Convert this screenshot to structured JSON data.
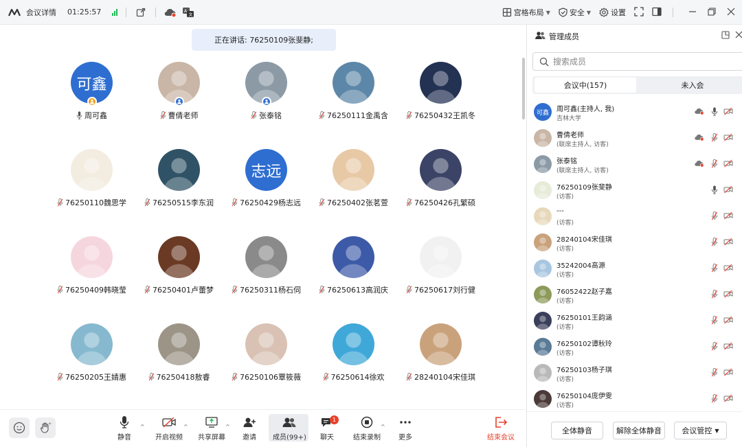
{
  "topbar": {
    "title": "会议详情",
    "time": "01:25:57",
    "layout_label": "宫格布局",
    "security_label": "安全",
    "settings_label": "设置"
  },
  "speaker": {
    "text": "正在讲话: 76250109张斐静;"
  },
  "participants": [
    {
      "name": "周可鑫",
      "avatar_text": "可鑫",
      "avatar_color": "#2e6ed1",
      "badge": "host",
      "mic": "on"
    },
    {
      "name": "曹倩老师",
      "avatar_text": "",
      "avatar_color": "#c9b6a6",
      "badge": "cohost",
      "mic": "off"
    },
    {
      "name": "张泰铭",
      "avatar_text": "",
      "avatar_color": "#8c9aa6",
      "badge": "cohost",
      "mic": "off"
    },
    {
      "name": "76250111金禹含",
      "avatar_text": "",
      "avatar_color": "#5d87a8",
      "badge": "",
      "mic": "off"
    },
    {
      "name": "76250432王凯冬",
      "avatar_text": "",
      "avatar_color": "#233152",
      "badge": "",
      "mic": "off"
    },
    {
      "name": "76250110魏思学",
      "avatar_text": "",
      "avatar_color": "#f3ece0",
      "badge": "",
      "mic": "off"
    },
    {
      "name": "76250515李东润",
      "avatar_text": "",
      "avatar_color": "#2f5266",
      "badge": "",
      "mic": "off"
    },
    {
      "name": "76250429杨志远",
      "avatar_text": "志远",
      "avatar_color": "#2e6ed1",
      "badge": "",
      "mic": "off"
    },
    {
      "name": "76250402张茗萱",
      "avatar_text": "",
      "avatar_color": "#e8c9a6",
      "badge": "",
      "mic": "off"
    },
    {
      "name": "76250426孔繁硕",
      "avatar_text": "",
      "avatar_color": "#3b4466",
      "badge": "",
      "mic": "off"
    },
    {
      "name": "76250409韩晓莹",
      "avatar_text": "",
      "avatar_color": "#f6d6de",
      "badge": "",
      "mic": "off"
    },
    {
      "name": "76250401卢蕾梦",
      "avatar_text": "",
      "avatar_color": "#6b3a24",
      "badge": "",
      "mic": "off"
    },
    {
      "name": "76250311杨石伺",
      "avatar_text": "",
      "avatar_color": "#8a8a8a",
      "badge": "",
      "mic": "off"
    },
    {
      "name": "76250613高润庆",
      "avatar_text": "",
      "avatar_color": "#3d5aa8",
      "badge": "",
      "mic": "off"
    },
    {
      "name": "76250617刘行健",
      "avatar_text": "",
      "avatar_color": "#f1f1f1",
      "badge": "",
      "mic": "off"
    },
    {
      "name": "76250205王婧惠",
      "avatar_text": "",
      "avatar_color": "#86b9cf",
      "badge": "",
      "mic": "off"
    },
    {
      "name": "76250418敖睿",
      "avatar_text": "",
      "avatar_color": "#9c9486",
      "badge": "",
      "mic": "off"
    },
    {
      "name": "76250106覃筱薇",
      "avatar_text": "",
      "avatar_color": "#d9c2b4",
      "badge": "",
      "mic": "off"
    },
    {
      "name": "76250614徐欢",
      "avatar_text": "",
      "avatar_color": "#3fa8d8",
      "badge": "",
      "mic": "off"
    },
    {
      "name": "28240104宋佳琪",
      "avatar_text": "",
      "avatar_color": "#c9a27c",
      "badge": "",
      "mic": "off"
    }
  ],
  "toolbar": {
    "mute_label": "静音",
    "video_label": "开启视频",
    "share_label": "共享屏幕",
    "invite_label": "邀请",
    "members_label": "成员(99+)",
    "chat_label": "聊天",
    "chat_badge": "1",
    "record_label": "结束录制",
    "more_label": "更多",
    "end_label": "结束会议"
  },
  "panel": {
    "title": "管理成员",
    "search_placeholder": "搜索成员",
    "tab_in": "会议中(157)",
    "tab_out": "未入会",
    "members": [
      {
        "name": "周可鑫(主持人, 我)",
        "role": "吉林大学",
        "avatar_text": "可鑫",
        "avatar_color": "#2e6ed1",
        "cloud": true,
        "mic": "on",
        "cam": "off"
      },
      {
        "name": "曹倩老师",
        "role": "(联席主持人, 访客)",
        "avatar_text": "",
        "avatar_color": "#c9b6a6",
        "cloud": true,
        "mic": "off",
        "cam": "off"
      },
      {
        "name": "张泰铭",
        "role": "(联席主持人, 访客)",
        "avatar_text": "",
        "avatar_color": "#8c9aa6",
        "cloud": true,
        "mic": "off",
        "cam": "off"
      },
      {
        "name": "76250109张斐静",
        "role": "(访客)",
        "avatar_text": "",
        "avatar_color": "#e6ecd8",
        "cloud": false,
        "mic": "on",
        "cam": "off"
      },
      {
        "name": "---",
        "role": "(访客)",
        "avatar_text": "",
        "avatar_color": "#e8d8bb",
        "cloud": false,
        "mic": "off",
        "cam": "off"
      },
      {
        "name": "28240104宋佳琪",
        "role": "(访客)",
        "avatar_text": "",
        "avatar_color": "#c9a27c",
        "cloud": false,
        "mic": "off",
        "cam": "off"
      },
      {
        "name": "35242004高源",
        "role": "(访客)",
        "avatar_text": "",
        "avatar_color": "#a8c6e0",
        "cloud": false,
        "mic": "off",
        "cam": "off"
      },
      {
        "name": "76052422赵子嘉",
        "role": "(访客)",
        "avatar_text": "",
        "avatar_color": "#8d9a5a",
        "cloud": false,
        "mic": "off",
        "cam": "off"
      },
      {
        "name": "76250101王韵涵",
        "role": "(访客)",
        "avatar_text": "",
        "avatar_color": "#3a3f5a",
        "cloud": false,
        "mic": "off",
        "cam": "off"
      },
      {
        "name": "76250102谭秋玲",
        "role": "(访客)",
        "avatar_text": "",
        "avatar_color": "#5a7a96",
        "cloud": false,
        "mic": "off",
        "cam": "off"
      },
      {
        "name": "76250103杨子琪",
        "role": "(访客)",
        "avatar_text": "",
        "avatar_color": "#b9b9b9",
        "cloud": false,
        "mic": "off",
        "cam": "off"
      },
      {
        "name": "76250104庞伊雯",
        "role": "(访客)",
        "avatar_text": "",
        "avatar_color": "#4a3a38",
        "cloud": false,
        "mic": "off",
        "cam": "off"
      }
    ],
    "mute_all": "全体静音",
    "unmute_all": "解除全体静音",
    "control": "会议管控"
  },
  "colors": {
    "accent": "#2e6ed1",
    "danger": "#e6412c",
    "signal": "#1db954"
  }
}
